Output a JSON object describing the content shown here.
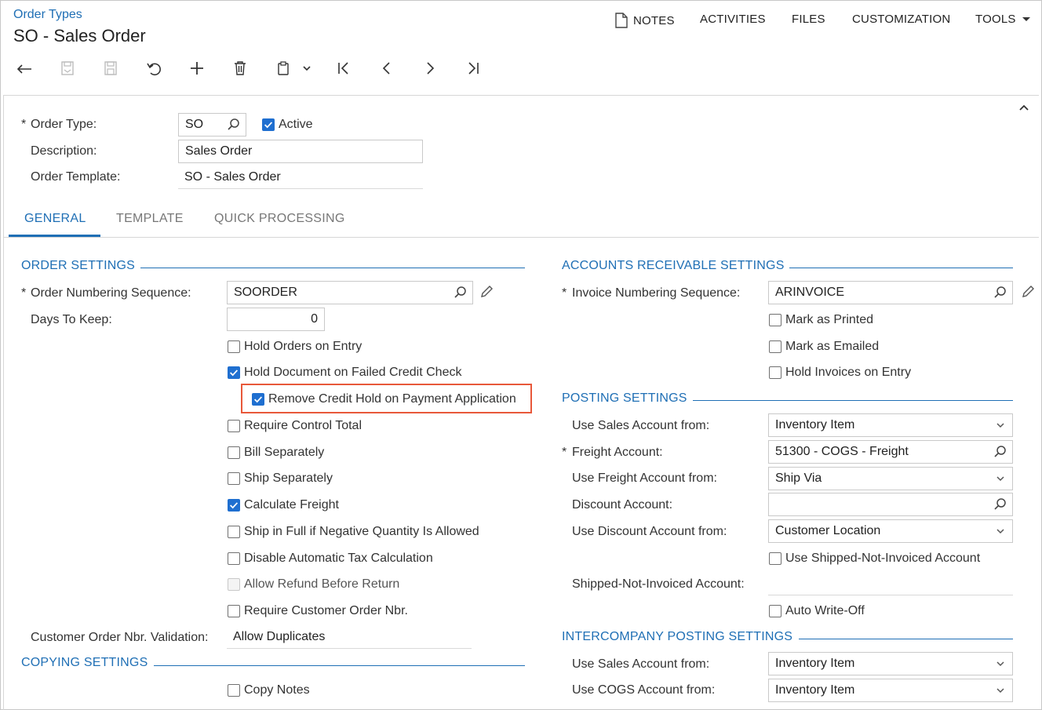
{
  "header": {
    "breadcrumb": "Order Types",
    "title": "SO - Sales Order"
  },
  "topnav": {
    "notes": "NOTES",
    "activities": "ACTIVITIES",
    "files": "FILES",
    "customization": "CUSTOMIZATION",
    "tools": "TOOLS"
  },
  "summary": {
    "order_type_label": "Order Type:",
    "order_type_value": "SO",
    "active_label": "Active",
    "active_checked": true,
    "description_label": "Description:",
    "description_value": "Sales Order",
    "template_label": "Order Template:",
    "template_value": "SO - Sales Order"
  },
  "tabs": [
    {
      "label": "GENERAL"
    },
    {
      "label": "TEMPLATE"
    },
    {
      "label": "QUICK PROCESSING"
    }
  ],
  "order_settings": {
    "title": "ORDER SETTINGS",
    "numbering_label": "Order Numbering Sequence:",
    "numbering_value": "SOORDER",
    "days_label": "Days To Keep:",
    "days_value": "0",
    "checkboxes": [
      {
        "label": "Hold Orders on Entry",
        "checked": false
      },
      {
        "label": "Hold Document on Failed Credit Check",
        "checked": true
      },
      {
        "label": "Remove Credit Hold on Payment Application",
        "checked": true
      },
      {
        "label": "Require Control Total",
        "checked": false
      },
      {
        "label": "Bill Separately",
        "checked": false
      },
      {
        "label": "Ship Separately",
        "checked": false
      },
      {
        "label": "Calculate Freight",
        "checked": true
      },
      {
        "label": "Ship in Full if Negative Quantity Is Allowed",
        "checked": false
      },
      {
        "label": "Disable Automatic Tax Calculation",
        "checked": false
      },
      {
        "label": "Allow Refund Before Return",
        "checked": false,
        "disabled": true
      },
      {
        "label": "Require Customer Order Nbr.",
        "checked": false
      }
    ],
    "validation_label": "Customer Order Nbr. Validation:",
    "validation_value": "Allow Duplicates"
  },
  "copying_settings": {
    "title": "COPYING SETTINGS",
    "copy_notes_label": "Copy Notes",
    "copy_notes_checked": false
  },
  "ar_settings": {
    "title": "ACCOUNTS RECEIVABLE SETTINGS",
    "invoice_numbering_label": "Invoice Numbering Sequence:",
    "invoice_numbering_value": "ARINVOICE",
    "mark_printed_label": "Mark as Printed",
    "mark_emailed_label": "Mark as Emailed",
    "hold_invoices_label": "Hold Invoices on Entry"
  },
  "posting_settings": {
    "title": "POSTING SETTINGS",
    "sales_account_from_label": "Use Sales Account from:",
    "sales_account_from_value": "Inventory Item",
    "freight_account_label": "Freight Account:",
    "freight_account_value": "51300 - COGS - Freight",
    "freight_from_label": "Use Freight Account from:",
    "freight_from_value": "Ship Via",
    "discount_account_label": "Discount Account:",
    "discount_account_value": "",
    "discount_from_label": "Use Discount Account from:",
    "discount_from_value": "Customer Location",
    "shipped_not_invoiced_cb_label": "Use Shipped-Not-Invoiced Account",
    "shipped_not_invoiced_label": "Shipped-Not-Invoiced Account:",
    "auto_writeoff_label": "Auto Write-Off"
  },
  "intercompany": {
    "title": "INTERCOMPANY POSTING SETTINGS",
    "sales_from_label": "Use Sales Account from:",
    "sales_from_value": "Inventory Item",
    "cogs_from_label": "Use COGS Account from:",
    "cogs_from_value": "Inventory Item"
  },
  "colors": {
    "accent": "#1f6fb5",
    "checkbox": "#1f6fd0",
    "highlight": "#e8583a"
  }
}
